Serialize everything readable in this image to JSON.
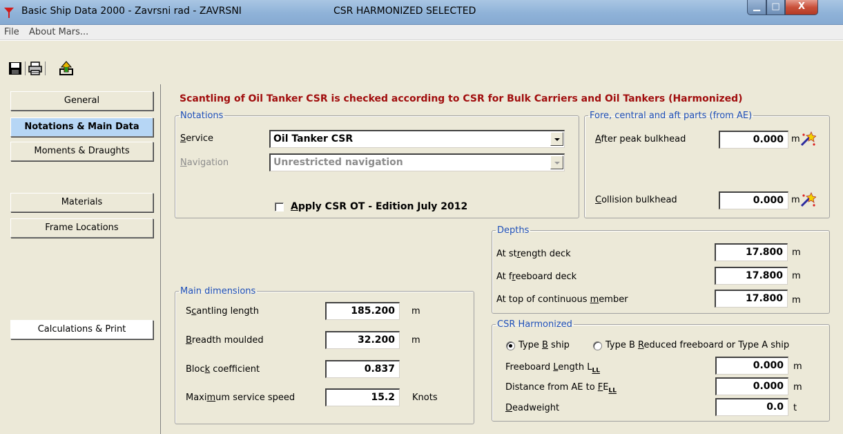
{
  "window": {
    "title": "Basic Ship Data 2000 - Zavrsni rad - ZAVRSNI",
    "selection_status": "CSR HARMONIZED SELECTED",
    "min_symbol": "▁",
    "max_symbol": "□",
    "close_symbol": "X"
  },
  "menu": {
    "items": [
      "File",
      "About Mars..."
    ]
  },
  "toolbar": {
    "buttons": [
      "save-icon",
      "print-icon",
      "export-icon"
    ]
  },
  "sidebar": {
    "items": [
      {
        "label": "General",
        "state": "normal"
      },
      {
        "label": "Notations & Main Data",
        "state": "active"
      },
      {
        "label": "Moments & Draughts",
        "state": "normal"
      },
      {
        "label": "Materials",
        "state": "normal"
      },
      {
        "label": "Frame Locations",
        "state": "normal"
      },
      {
        "label": "Calculations & Print",
        "state": "white"
      }
    ]
  },
  "main": {
    "headline": "Scantling of Oil Tanker CSR is checked according to CSR for Bulk Carriers and Oil Tankers (Harmonized)",
    "notations": {
      "legend": "Notations",
      "service_label": "Service",
      "service_value": "Oil Tanker CSR",
      "navigation_label": "Navigation",
      "navigation_value": "Unrestricted navigation",
      "apply_csr_label": "Apply CSR OT - Edition July 2012",
      "apply_csr_checked": false
    },
    "fore_aft": {
      "legend": "Fore, central and aft parts (from AE)",
      "after_peak_label": "After peak bulkhead",
      "after_peak_value": "0.000",
      "collision_label": "Collision bulkhead",
      "collision_value": "0.000",
      "unit": "m"
    },
    "depths": {
      "legend": "Depths",
      "strength_label": "At strength deck",
      "strength_value": "17.800",
      "freeboard_label": "At freeboard deck",
      "freeboard_value": "17.800",
      "top_label": "At top of continuous member",
      "top_value": "17.800",
      "unit": "m"
    },
    "main_dimensions": {
      "legend": "Main dimensions",
      "length_label": "Scantling length",
      "length_value": "185.200",
      "length_unit": "m",
      "breadth_label": "Breadth moulded",
      "breadth_value": "32.200",
      "breadth_unit": "m",
      "block_label": "Block coefficient",
      "block_value": "0.837",
      "speed_label": "Maximum service speed",
      "speed_value": "15.2",
      "speed_unit": "Knots"
    },
    "csr_harmonized": {
      "legend": "CSR Harmonized",
      "type_b_label": "Type B ship",
      "type_b_selected": true,
      "type_reduced_label": "Type B Reduced freeboard or Type A ship",
      "freeboard_length_label": "Freeboard Length L",
      "freeboard_length_sub": "LL",
      "freeboard_length_value": "0.000",
      "distance_label": "Distance from AE to FE",
      "distance_sub": "LL",
      "distance_value": "0.000",
      "deadweight_label": "Deadweight",
      "deadweight_value": "0.0",
      "unit_m": "m",
      "unit_t": "t"
    }
  }
}
